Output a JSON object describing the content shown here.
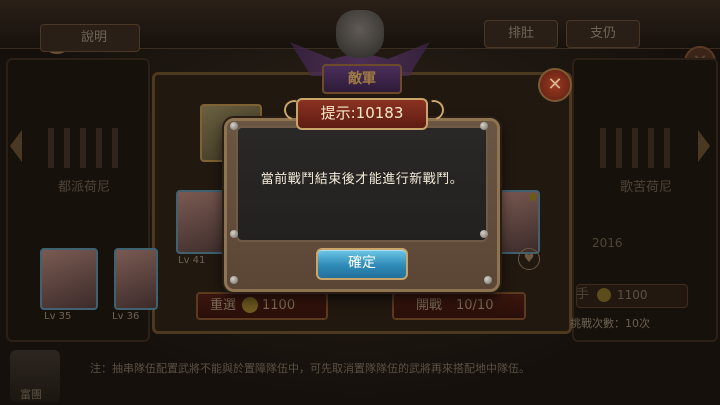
{
  "background": {
    "help_label": "說明",
    "tab_1_label": "排肚",
    "tab_2_label": "支仍",
    "left_caption": "都派荷尼",
    "right_caption": "歌苦荷尼",
    "power_text": "2016",
    "note_text": "注：抽串隊伍配置武將不能與於置障隊伍中，可先取消置隊隊伍的武將再來搭配地中隊伍。",
    "bottom_char_label": "富團",
    "challenge_text": "挑戰次數：10次"
  },
  "enemy_dialog": {
    "title": "敵軍",
    "close_icon": "close-icon",
    "portrait_level_left": "Lv 41",
    "bottom_level_1": "Lv 35",
    "bottom_level_2": "Lv 36",
    "reselect_label": "重選",
    "reselect_cost": "1100",
    "battle_label": "開戰",
    "battle_count": "10/10",
    "right_hand_label": "手",
    "right_cost": "1100"
  },
  "modal": {
    "title": "提示:10183",
    "message": "當前戰鬥結束後才能進行新戰鬥。",
    "confirm_label": "確定"
  },
  "colors": {
    "title_plate": "#8b3222",
    "confirm_button": "#2e8ab6",
    "frame": "#8e7451",
    "gold_trim": "#c9a56b"
  }
}
